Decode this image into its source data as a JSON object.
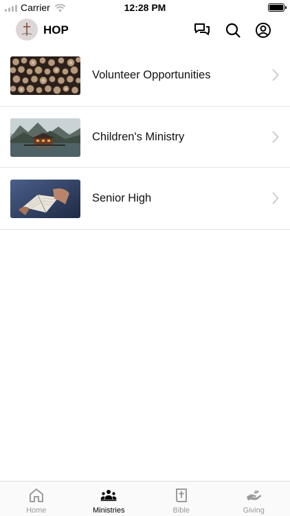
{
  "status_bar": {
    "carrier": "Carrier",
    "time": "12:28 PM"
  },
  "header": {
    "title": "HOP",
    "icons": [
      "chat-icon",
      "search-icon",
      "account-icon"
    ]
  },
  "ministries": [
    {
      "label": "Volunteer Opportunities",
      "image": "log-pile"
    },
    {
      "label": "Children's Ministry",
      "image": "lake-cabin"
    },
    {
      "label": "Senior High",
      "image": "open-bible"
    }
  ],
  "tab_bar": {
    "tabs": [
      {
        "label": "Home",
        "icon": "home-icon",
        "active": false
      },
      {
        "label": "Ministries",
        "icon": "people-icon",
        "active": true
      },
      {
        "label": "Bible",
        "icon": "bible-icon",
        "active": false
      },
      {
        "label": "Giving",
        "icon": "giving-hand-icon",
        "active": false
      }
    ]
  },
  "colors": {
    "active_tab": "#000000",
    "inactive_tab": "#9a9a9a",
    "divider": "#e4e4e4"
  }
}
